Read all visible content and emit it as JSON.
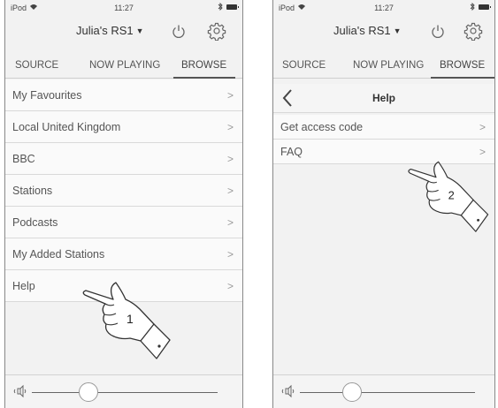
{
  "status": {
    "device": "iPod",
    "time": "11:27"
  },
  "header": {
    "device_name": "Julia's RS1"
  },
  "tabs": [
    {
      "label": "SOURCE"
    },
    {
      "label": "NOW PLAYING"
    },
    {
      "label": "BROWSE"
    }
  ],
  "browse": {
    "items": [
      {
        "label": "My Favourites"
      },
      {
        "label": "Local United Kingdom"
      },
      {
        "label": "BBC"
      },
      {
        "label": "Stations"
      },
      {
        "label": "Podcasts"
      },
      {
        "label": "My Added Stations"
      },
      {
        "label": "Help"
      }
    ]
  },
  "help": {
    "title": "Help",
    "items": [
      {
        "label": "Get access code"
      },
      {
        "label": "FAQ"
      }
    ]
  },
  "callouts": {
    "step1": "1",
    "step2": "2"
  },
  "colors": {
    "background": "#f2f2f2",
    "text": "#555555",
    "divider": "#d9d9d9"
  },
  "icons": [
    "wifi-icon",
    "bluetooth-icon",
    "battery-icon",
    "power-icon",
    "gear-icon",
    "back-chevron-icon",
    "chevron-right-icon",
    "speaker-icon",
    "pointing-hand-icon"
  ]
}
